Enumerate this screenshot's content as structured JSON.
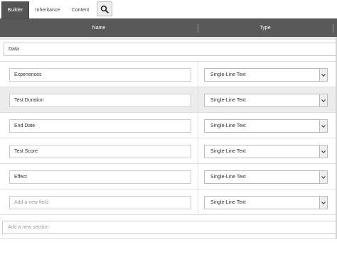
{
  "tabs": [
    {
      "label": "Builder",
      "active": true
    },
    {
      "label": "Inheritance",
      "active": false
    },
    {
      "label": "Content",
      "active": false
    }
  ],
  "toolbar": {
    "search_icon": "search-icon"
  },
  "header": {
    "name_label": "Name",
    "type_label": "Type"
  },
  "section": {
    "value": "Data"
  },
  "fields": [
    {
      "name": "Experiences",
      "type": "Single-Line Text"
    },
    {
      "name": "Test Duration",
      "type": "Single-Line Text"
    },
    {
      "name": "End Date",
      "type": "Single-Line Text"
    },
    {
      "name": "Test Score",
      "type": "Single-Line Text"
    },
    {
      "name": "Effect",
      "type": "Single-Line Text"
    }
  ],
  "new_field": {
    "placeholder": "Add a new field",
    "type": "Single-Line Text"
  },
  "new_section": {
    "placeholder": "Add a new section"
  },
  "colors": {
    "header_bg": "#595959",
    "active_tab_bg": "#555555",
    "highlight_row": "#ececec"
  }
}
